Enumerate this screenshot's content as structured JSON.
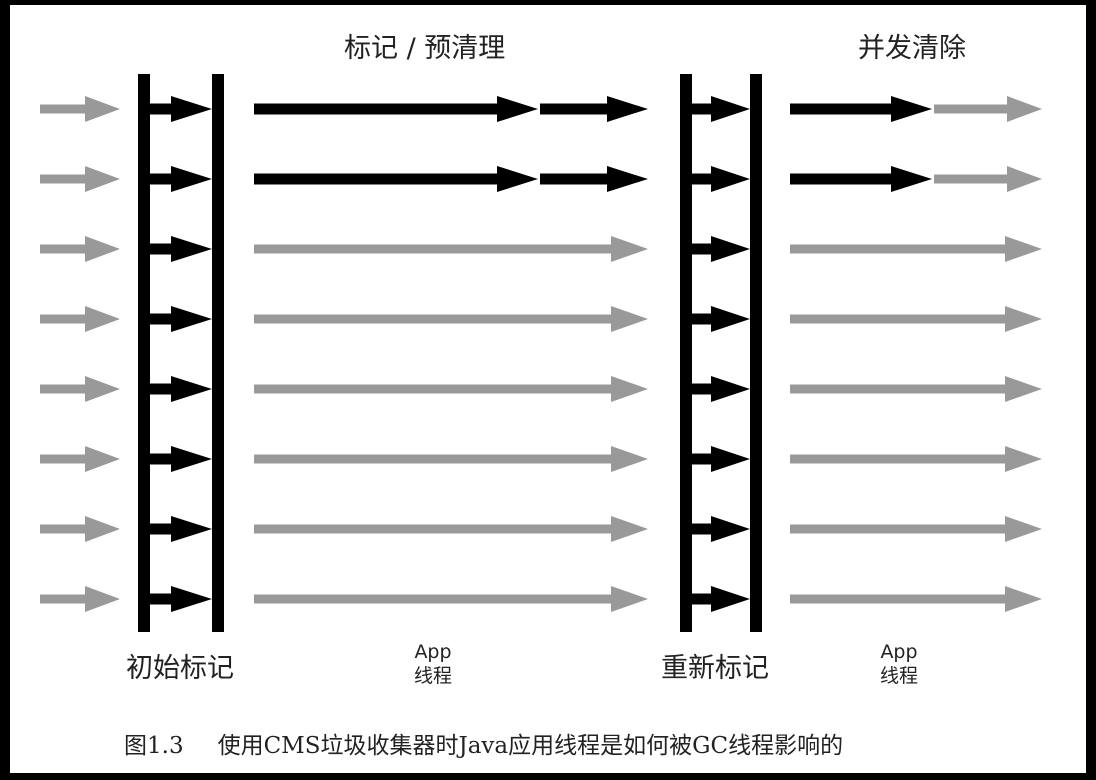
{
  "phases": {
    "mark_preclean": "标记 / 预清理",
    "concurrent_sweep": "并发清除",
    "initial_mark": "初始标记",
    "remark": "重新标记",
    "app_threads_1": "App\n线程",
    "app_threads_2": "App\n线程"
  },
  "caption": {
    "figure_number": "图1.3",
    "text": "使用CMS垃圾收集器时Java应用线程是如何被GC线程影响的"
  },
  "colors": {
    "app_thread": "#999999",
    "gc_thread": "#000000",
    "background": "#ffffff",
    "border": "#000000"
  },
  "thread_rows": 8,
  "gc_concurrent_rows": 2
}
